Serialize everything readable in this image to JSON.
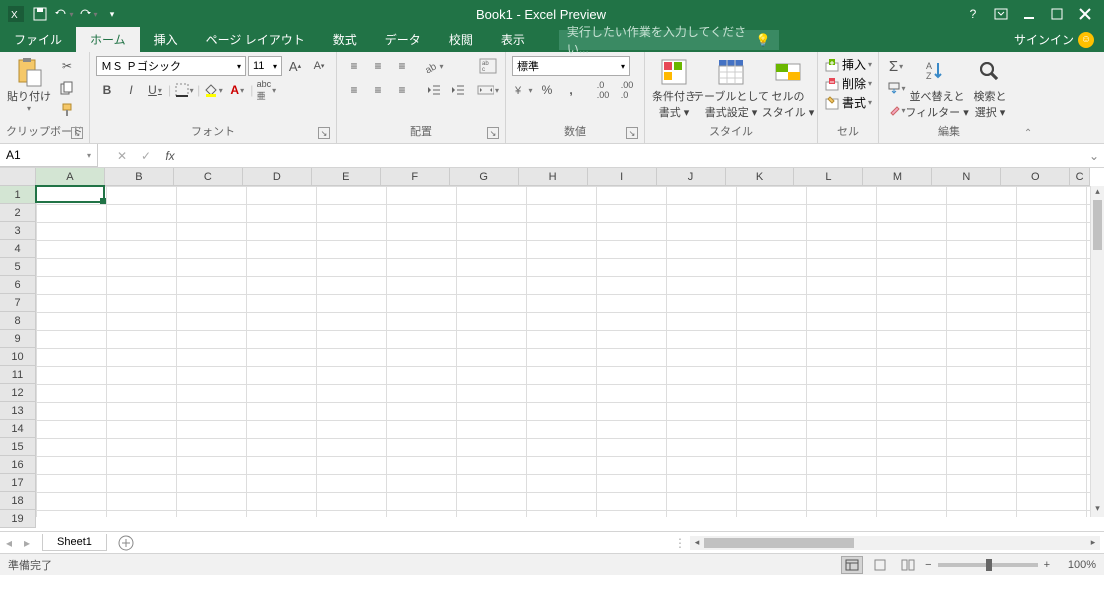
{
  "title": "Book1 - Excel Preview",
  "qat": {
    "save": "save",
    "undo": "undo",
    "redo": "redo"
  },
  "win": {
    "help": "?",
    "signin": "サインイン"
  },
  "tabs": {
    "file": "ファイル",
    "home": "ホーム",
    "insert": "挿入",
    "pagelayout": "ページ レイアウト",
    "formulas": "数式",
    "data": "データ",
    "review": "校閲",
    "view": "表示"
  },
  "tellme_placeholder": "実行したい作業を入力してください...",
  "clipboard": {
    "paste": "貼り付け",
    "label": "クリップボード"
  },
  "font": {
    "name": "ＭＳ Ｐゴシック",
    "size": "11",
    "bold": "B",
    "italic": "I",
    "underline": "U",
    "label": "フォント"
  },
  "alignment": {
    "label": "配置"
  },
  "number": {
    "format": "標準",
    "label": "数値"
  },
  "styles": {
    "cond": "条件付き\n書式 ▾",
    "table": "テーブルとして\n書式設定 ▾",
    "cell": "セルの\nスタイル ▾",
    "label": "スタイル"
  },
  "cells": {
    "insert": "挿入",
    "delete": "削除",
    "format": "書式",
    "label": "セル"
  },
  "editing": {
    "sort": "並べ替えと\nフィルター ▾",
    "find": "検索と\n選択 ▾",
    "label": "編集"
  },
  "namebox": "A1",
  "columns": [
    "A",
    "B",
    "C",
    "D",
    "E",
    "F",
    "G",
    "H",
    "I",
    "J",
    "K",
    "L",
    "M",
    "N",
    "O"
  ],
  "last_col_visible": "C",
  "rows": [
    1,
    2,
    3,
    4,
    5,
    6,
    7,
    8,
    9,
    10,
    11,
    12,
    13,
    14,
    15,
    16,
    17,
    18,
    19
  ],
  "sheet": "Sheet1",
  "status": "準備完了",
  "zoom": "100%"
}
